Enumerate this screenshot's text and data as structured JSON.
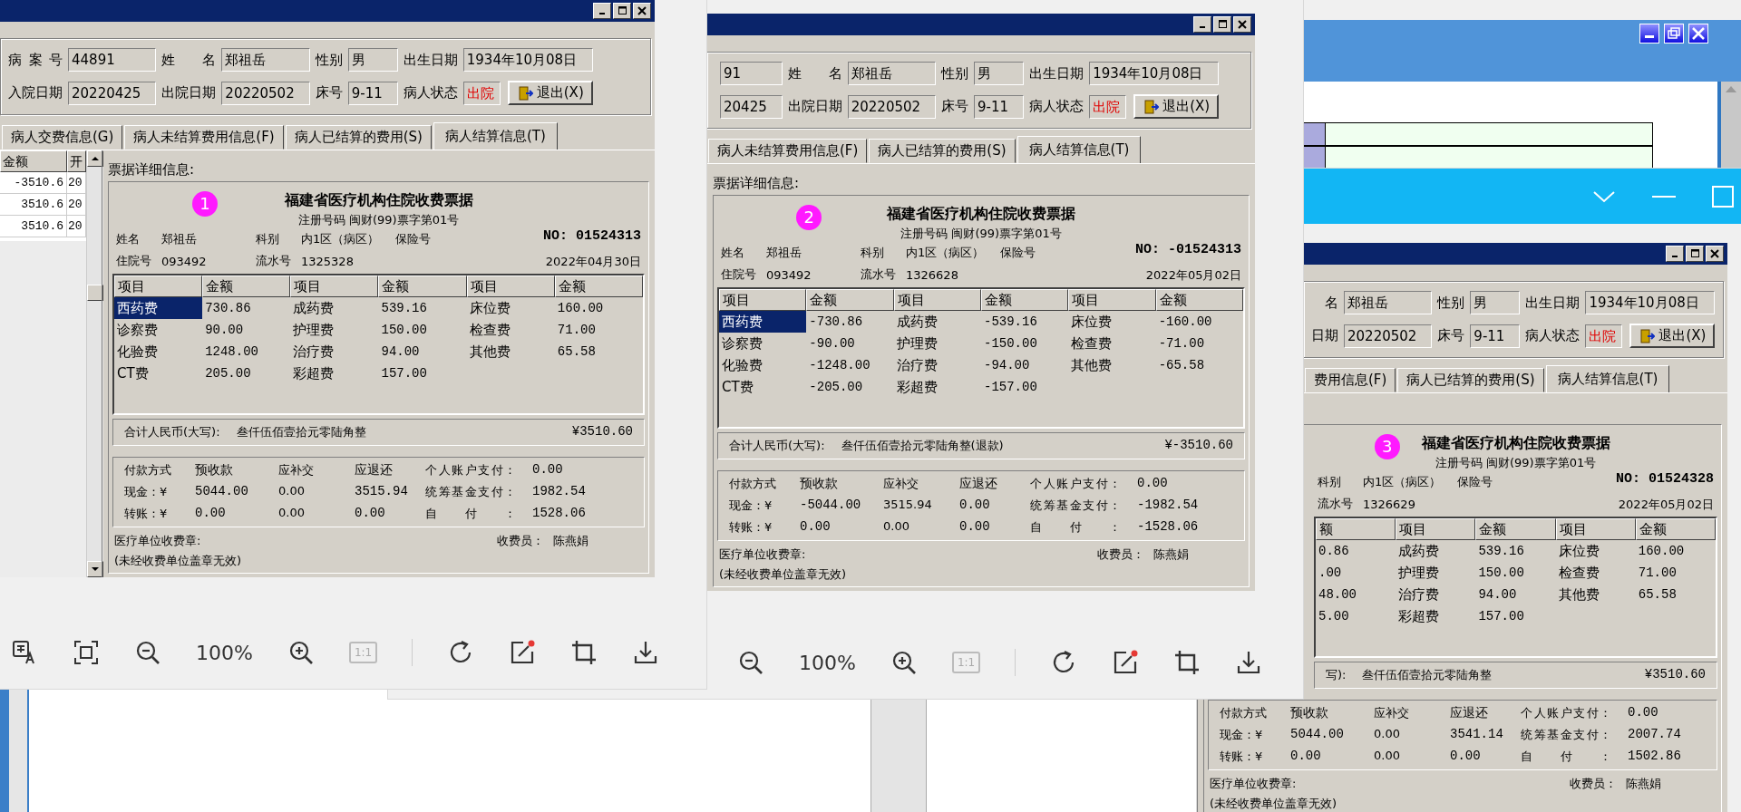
{
  "viewers": [
    {
      "has_title_bar": false,
      "shot": {
        "list": {
          "columns": [
            "金额",
            "开"
          ],
          "rows": [
            [
              "-3510.6",
              "20"
            ],
            [
              "3510.6",
              "20"
            ],
            [
              "3510.6",
              "20"
            ]
          ]
        },
        "header": [
          [
            {
              "kind": "field",
              "label": "病案号",
              "value": "44891"
            },
            {
              "kind": "field",
              "label": "姓名",
              "value": "郑祖岳"
            },
            {
              "kind": "field",
              "label": "性别",
              "value": "男"
            },
            {
              "kind": "field",
              "label": "出生日期",
              "value": "1934年10月08日"
            }
          ],
          [
            {
              "kind": "field",
              "label": "入院日期",
              "value": "20220425"
            },
            {
              "kind": "field",
              "label": "出院日期",
              "value": "20220502"
            },
            {
              "kind": "field",
              "label": "床号",
              "value": "9-11"
            },
            {
              "kind": "status",
              "label": "病人状态",
              "value": "出院"
            }
          ]
        ],
        "exit_button": "退出(X)",
        "tabs": [
          {
            "label": "病人交费信息(G)",
            "selected": false
          },
          {
            "label": "病人未结算费用信息(F)",
            "selected": false
          },
          {
            "label": "病人已结算的费用(S)",
            "selected": false
          },
          {
            "label": "病人结算信息(T)",
            "selected": true
          }
        ],
        "caption": "票据详细信息:",
        "receipt": {
          "badge": "1",
          "title": "福建省医疗机构住院收费票据",
          "registration": "注册号码 闽财(99)票字第01号",
          "number": "NO: 01524313",
          "info": [
            [
              "姓名",
              "郑祖岳",
              "科别",
              "内1区（病区）",
              "保险号"
            ],
            [
              "住院号",
              "093492",
              "流水号",
              "1325328"
            ]
          ],
          "date": "2022年04月30日",
          "table": {
            "columns": [
              "项目",
              "金额",
              "项目",
              "金额",
              "项目",
              "金额"
            ],
            "rows": [
              {
                "cells": [
                  "西药费",
                  "730.86",
                  "成药费",
                  "539.16",
                  "床位费",
                  "160.00"
                ],
                "selected": true
              },
              {
                "cells": [
                  "诊察费",
                  "90.00",
                  "护理费",
                  "150.00",
                  "检查费",
                  "71.00"
                ],
                "selected": false
              },
              {
                "cells": [
                  "化验费",
                  "1248.00",
                  "治疗费",
                  "94.00",
                  "其他费",
                  "65.58"
                ],
                "selected": false
              },
              {
                "cells": [
                  "CT费",
                  "205.00",
                  "彩超费",
                  "157.00"
                ],
                "selected": false
              }
            ]
          },
          "total": {
            "label": "合计人民币(大写):",
            "words": "叁仟伍佰壹拾元零陆角整",
            "amount": "¥3510.60"
          },
          "payment": [
            [
              "付款方式",
              "预收款",
              "应补交",
              "应退还",
              "个人账户支付：",
              "0.00"
            ],
            [
              "现金：¥",
              "5044.00",
              "0.00",
              "3515.94",
              "统筹基金支付：",
              "1982.54"
            ],
            [
              "转账：¥",
              "0.00",
              "0.00",
              "0.00",
              "自付：",
              "1528.06"
            ]
          ],
          "stamp": "医疗单位收费章:",
          "cashier_label": "收费员：",
          "cashier": "陈燕娟",
          "note": "(未经收费单位盖章无效)"
        }
      },
      "toolbar": [
        {
          "kind": "translate"
        },
        {
          "kind": "fit"
        },
        {
          "kind": "zoom-out"
        },
        {
          "kind": "zoom-level",
          "label": "100%"
        },
        {
          "kind": "zoom-in"
        },
        {
          "kind": "actual-size",
          "label": "1:1",
          "disabled": true
        },
        {
          "kind": "divider"
        },
        {
          "kind": "rotate"
        },
        {
          "kind": "edit"
        },
        {
          "kind": "crop"
        },
        {
          "kind": "download"
        }
      ]
    },
    {
      "has_title_bar": false,
      "shot": {
        "header": [
          [
            {
              "kind": "cut",
              "value": "91"
            },
            {
              "kind": "field",
              "label": "姓名",
              "value": "郑祖岳"
            },
            {
              "kind": "field",
              "label": "性别",
              "value": "男"
            },
            {
              "kind": "field",
              "label": "出生日期",
              "value": "1934年10月08日"
            }
          ],
          [
            {
              "kind": "cut",
              "value": "20425"
            },
            {
              "kind": "field",
              "label": "出院日期",
              "value": "20220502"
            },
            {
              "kind": "field",
              "label": "床号",
              "value": "9-11"
            },
            {
              "kind": "status",
              "label": "病人状态",
              "value": "出院"
            }
          ]
        ],
        "exit_button": "退出(X)",
        "tabs": [
          {
            "label": "病人未结算费用信息(F)",
            "selected": false
          },
          {
            "label": "病人已结算的费用(S)",
            "selected": false
          },
          {
            "label": "病人结算信息(T)",
            "selected": true
          }
        ],
        "caption": "票据详细信息:",
        "receipt": {
          "badge": "2",
          "title": "福建省医疗机构住院收费票据",
          "registration": "注册号码 闽财(99)票字第01号",
          "number": "NO: -01524313",
          "info": [
            [
              "姓名",
              "郑祖岳",
              "科别",
              "内1区（病区）",
              "保险号"
            ],
            [
              "住院号",
              "093492",
              "流水号",
              "1326628"
            ]
          ],
          "date": "2022年05月02日",
          "table": {
            "columns": [
              "项目",
              "金额",
              "项目",
              "金额",
              "项目",
              "金额"
            ],
            "rows": [
              {
                "cells": [
                  "西药费",
                  "-730.86",
                  "成药费",
                  "-539.16",
                  "床位费",
                  "-160.00"
                ],
                "selected": true
              },
              {
                "cells": [
                  "诊察费",
                  "-90.00",
                  "护理费",
                  "-150.00",
                  "检查费",
                  "-71.00"
                ],
                "selected": false
              },
              {
                "cells": [
                  "化验费",
                  "-1248.00",
                  "治疗费",
                  "-94.00",
                  "其他费",
                  "-65.58"
                ],
                "selected": false
              },
              {
                "cells": [
                  "CT费",
                  "-205.00",
                  "彩超费",
                  "-157.00"
                ],
                "selected": false
              }
            ]
          },
          "total": {
            "label": "合计人民币(大写):",
            "words": "叁仟伍佰壹拾元零陆角整(退款)",
            "amount": "¥-3510.60"
          },
          "payment": [
            [
              "付款方式",
              "预收款",
              "应补交",
              "应退还",
              "个人账户支付：",
              "0.00"
            ],
            [
              "现金：¥",
              "-5044.00",
              "3515.94",
              "0.00",
              "统筹基金支付：",
              "-1982.54"
            ],
            [
              "转账：¥",
              "0.00",
              "0.00",
              "0.00",
              "自付：",
              "-1528.06"
            ]
          ],
          "stamp": "医疗单位收费章:",
          "cashier_label": "收费员：",
          "cashier": "陈燕娟",
          "note": "(未经收费单位盖章无效)"
        }
      },
      "toolbar": [
        {
          "kind": "zoom-out"
        },
        {
          "kind": "zoom-level",
          "label": "100%"
        },
        {
          "kind": "zoom-in"
        },
        {
          "kind": "actual-size",
          "label": "1:1",
          "disabled": true
        },
        {
          "kind": "divider"
        },
        {
          "kind": "rotate"
        },
        {
          "kind": "edit"
        },
        {
          "kind": "crop"
        },
        {
          "kind": "download"
        }
      ]
    },
    {
      "has_title_bar": true,
      "shot": {
        "header": [
          [
            {
              "kind": "cut",
              "label": "名",
              "value": "郑祖岳"
            },
            {
              "kind": "field",
              "label": "性别",
              "value": "男"
            },
            {
              "kind": "field",
              "label": "出生日期",
              "value": "1934年10月08日"
            }
          ],
          [
            {
              "kind": "cut",
              "label": "日期",
              "value": "20220502"
            },
            {
              "kind": "field",
              "label": "床号",
              "value": "9-11"
            },
            {
              "kind": "status",
              "label": "病人状态",
              "value": "出院"
            }
          ]
        ],
        "exit_button": "退出(X)",
        "tabs": [
          {
            "label": "费用信息(F)",
            "selected": false
          },
          {
            "label": "病人已结算的费用(S)",
            "selected": false
          },
          {
            "label": "病人结算信息(T)",
            "selected": true
          }
        ],
        "receipt": {
          "badge": "3",
          "title": "福建省医疗机构住院收费票据",
          "registration": "注册号码 闽财(99)票字第01号",
          "number": "NO: 01524328",
          "info": [
            [
              "科别",
              "内1区（病区）",
              "保险号"
            ],
            [
              "流水号",
              "1326629"
            ]
          ],
          "date": "2022年05月02日",
          "table": {
            "columns": [
              "额",
              "项目",
              "金额",
              "项目",
              "金额"
            ],
            "rows": [
              {
                "cells": [
                  "0.86",
                  "成药费",
                  "539.16",
                  "床位费",
                  "160.00"
                ],
                "selected": false
              },
              {
                "cells": [
                  ".00",
                  "护理费",
                  "150.00",
                  "检查费",
                  "71.00"
                ],
                "selected": false
              },
              {
                "cells": [
                  "48.00",
                  "治疗费",
                  "94.00",
                  "其他费",
                  "65.58"
                ],
                "selected": false
              },
              {
                "cells": [
                  "5.00",
                  "彩超费",
                  "157.00"
                ],
                "selected": false
              }
            ]
          },
          "total": {
            "label": "写):",
            "words": "叁仟伍佰壹拾元零陆角整",
            "amount": "¥3510.60"
          },
          "payment": [
            [
              "付款方式",
              "预收款",
              "应补交",
              "应退还",
              "个人账户支付：",
              "0.00"
            ],
            [
              "现金：¥",
              "5044.00",
              "0.00",
              "3541.14",
              "统筹基金支付：",
              "2007.74"
            ],
            [
              "转账：¥",
              "0.00",
              "0.00",
              "0.00",
              "自付：",
              "1502.86"
            ]
          ],
          "stamp": "医疗单位收费章:",
          "cashier_label": "收费员：",
          "cashier": "陈燕娟",
          "note": "(未经收费单位盖章无效)"
        }
      }
    }
  ]
}
